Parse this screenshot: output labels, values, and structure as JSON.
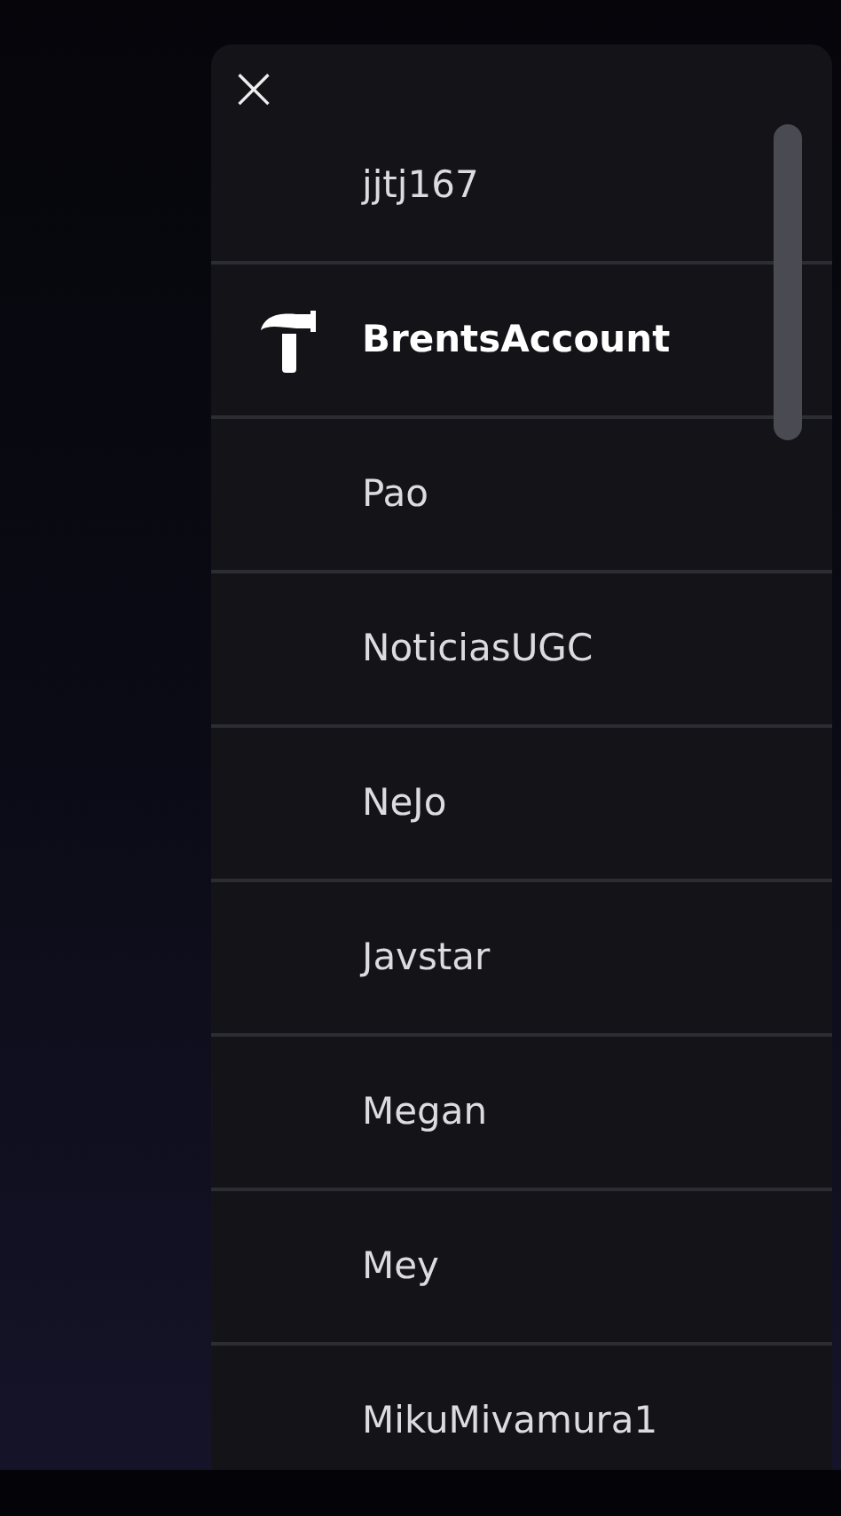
{
  "close_button": {
    "label": "×"
  },
  "accounts": [
    {
      "name": "jjtj167",
      "selected": false
    },
    {
      "name": "BrentsAccount",
      "selected": true
    },
    {
      "name": "Pao",
      "selected": false
    },
    {
      "name": "NoticiasUGC",
      "selected": false
    },
    {
      "name": "NeJo",
      "selected": false
    },
    {
      "name": "Javstar",
      "selected": false
    },
    {
      "name": "Megan",
      "selected": false
    },
    {
      "name": "Mey",
      "selected": false
    },
    {
      "name": "MikuMivamura1",
      "selected": false
    }
  ]
}
